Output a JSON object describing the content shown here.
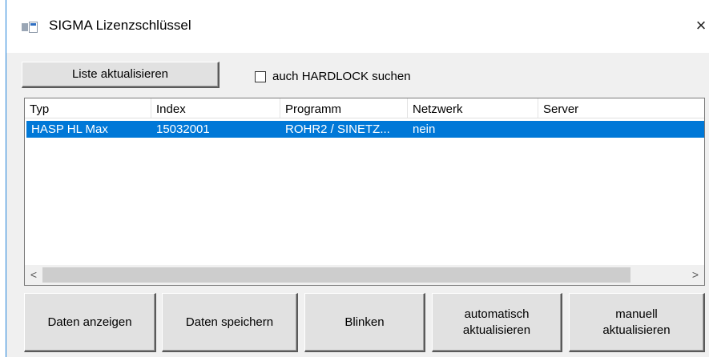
{
  "window": {
    "title": "SIGMA Lizenzschlüssel",
    "close_glyph": "×",
    "icon": "app-window-icon"
  },
  "toolbar": {
    "refresh_list_label": "Liste aktualisieren",
    "hardlock_checkbox_label": "auch HARDLOCK suchen",
    "hardlock_checked": false
  },
  "table": {
    "columns": [
      "Typ",
      "Index",
      "Programm",
      "Netzwerk",
      "Server"
    ],
    "rows": [
      {
        "typ": "HASP HL Max",
        "index": "15032001",
        "programm": "ROHR2 / SINETZ...",
        "netzwerk": "nein",
        "server": "",
        "selected": true
      }
    ],
    "scroll_left_glyph": "<",
    "scroll_right_glyph": ">"
  },
  "buttons": {
    "show_data": "Daten anzeigen",
    "save_data": "Daten speichern",
    "blink": "Blinken",
    "auto_refresh_line1": "automatisch",
    "auto_refresh_line2": "aktualisieren",
    "manual_refresh_line1": "manuell",
    "manual_refresh_line2": "aktualisieren"
  },
  "colors": {
    "selection": "#0078d7",
    "window_border": "#1f80d8",
    "dialog_bg": "#f0f0f0"
  }
}
